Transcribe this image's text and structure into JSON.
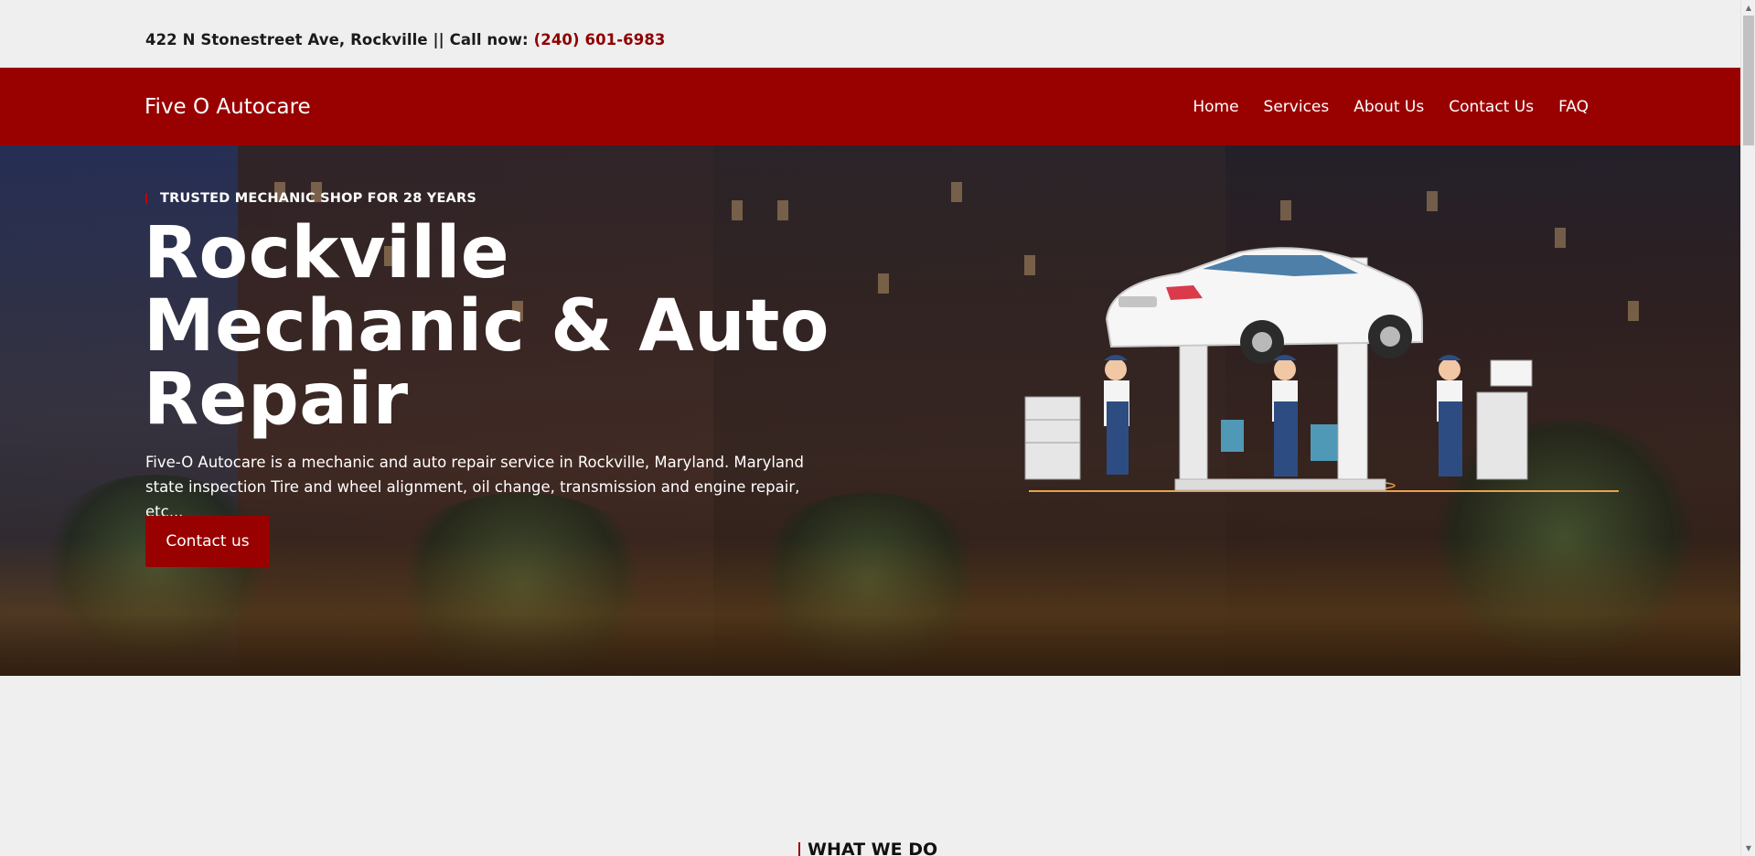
{
  "topbar": {
    "address": "422 N Stonestreet Ave, Rockville || Call now:",
    "phone": "(240) 601-6983"
  },
  "navbar": {
    "brand": "Five O Autocare",
    "links": [
      "Home",
      "Services",
      "About Us",
      "Contact Us",
      "FAQ"
    ]
  },
  "hero": {
    "eyebrow": "TRUSTED MECHANIC SHOP FOR 28 YEARS",
    "headline": "Rockville Mechanic & Auto Repair",
    "description": "Five-O Autocare is a mechanic and auto repair service in Rockville, Maryland. Maryland state inspection Tire and wheel alignment, oil change, transmission and engine repair, etc...",
    "cta": "Contact us"
  },
  "section": {
    "label": "WHAT WE DO"
  },
  "colors": {
    "brand": "#990000",
    "accent_text": "#8f0000",
    "background": "#efefef"
  },
  "icons": [
    "scroll-up-arrow-icon",
    "scroll-down-arrow-icon"
  ]
}
